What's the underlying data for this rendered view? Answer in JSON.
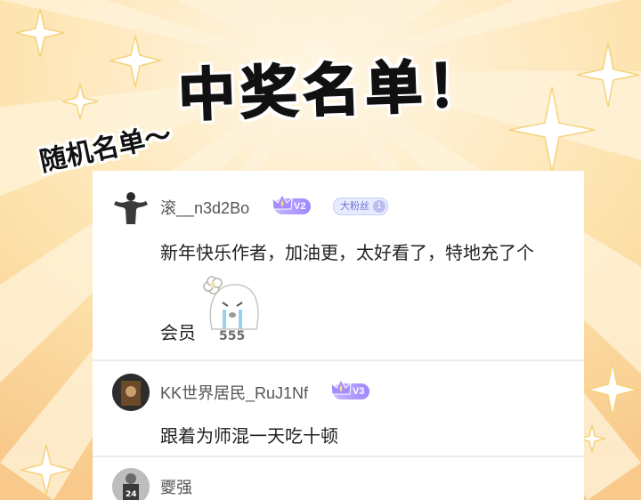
{
  "header": {
    "title": "中奖名单！",
    "subtitle": "随机名单～"
  },
  "comments": [
    {
      "username": "滚__n3d2Bo",
      "level": "V2",
      "fan_badge": "大粉丝",
      "fan_level": "1",
      "text_line1": "新年快乐作者，加油更，太好看了，特地充了个",
      "text_line2": "会员",
      "sticker_text": "555"
    },
    {
      "username": "KK世界居民_RuJ1Nf",
      "level": "V3",
      "text_line1": "跟着为师混一天吃十顿"
    },
    {
      "username": "夒强",
      "avatar_number": "24"
    }
  ],
  "colors": {
    "background": "#fbe6b6",
    "ray": "#fff3d6",
    "star": "#ffffff",
    "level_badge": "#9e86ff",
    "fan_badge": "#6d72d8"
  }
}
